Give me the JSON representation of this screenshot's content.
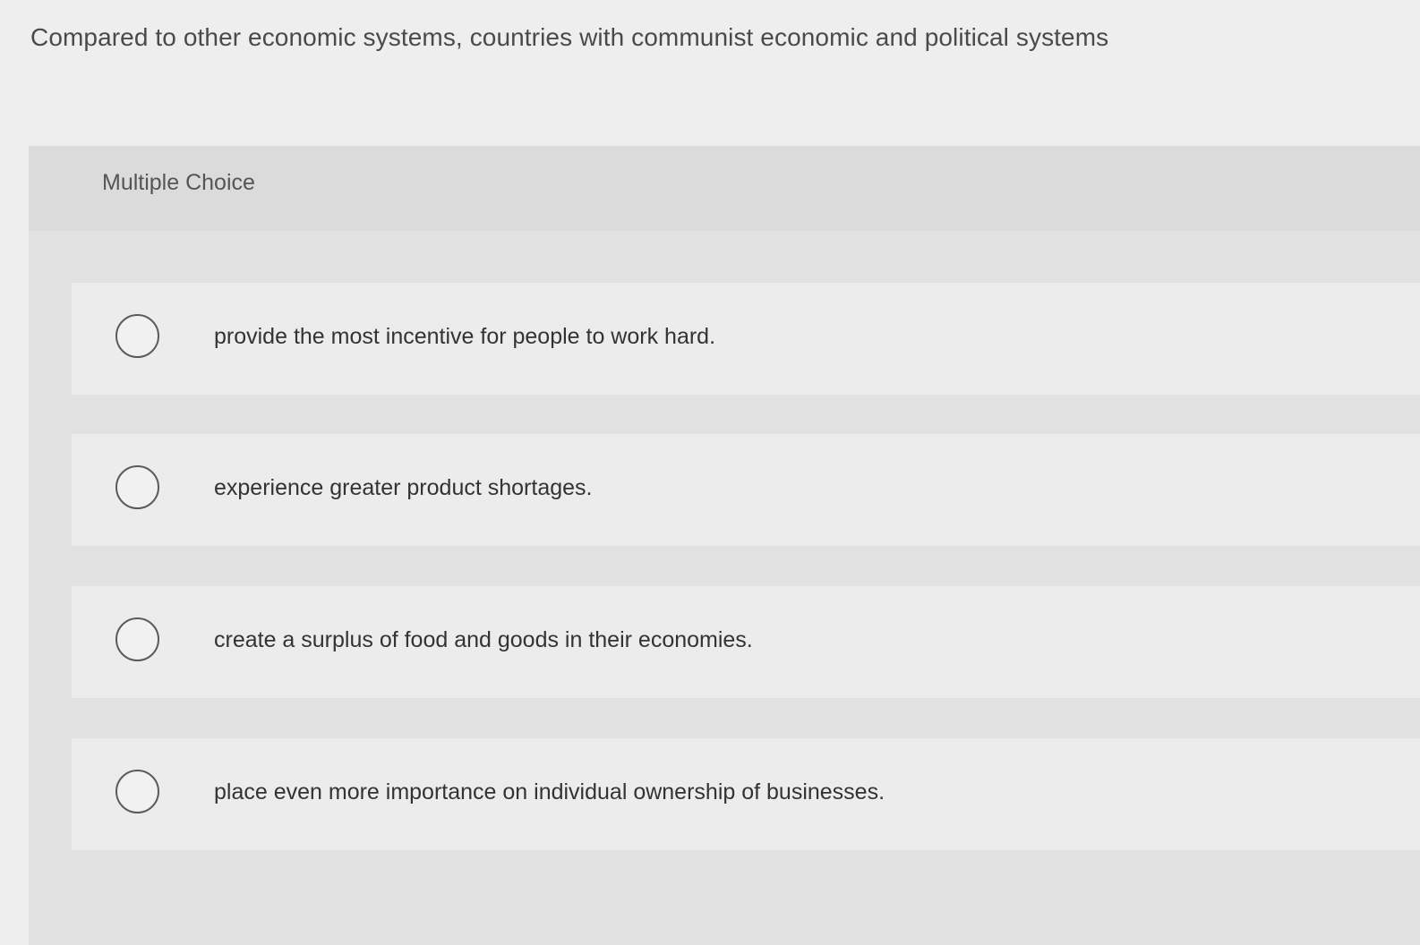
{
  "question": {
    "text": "Compared to other economic systems, countries with communist economic and political systems"
  },
  "quiz": {
    "type_label": "Multiple Choice",
    "options": [
      {
        "label": "provide the most incentive for people to work hard.",
        "selected": false
      },
      {
        "label": "experience greater product shortages.",
        "selected": false
      },
      {
        "label": "create a surplus of food and goods in their economies.",
        "selected": false
      },
      {
        "label": "place even more importance on individual ownership of businesses.",
        "selected": false
      }
    ]
  },
  "icons": {
    "radio": "radio-button-unchecked-icon"
  }
}
